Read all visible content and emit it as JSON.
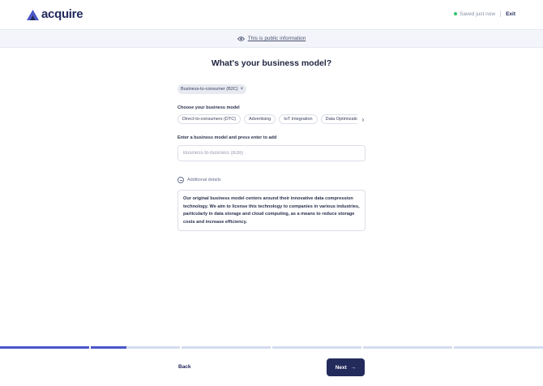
{
  "header": {
    "logo_text": "acquire",
    "saved_text": "Saved just now",
    "exit_label": "Exit",
    "accent_color": "#232a5c",
    "saved_dot_color": "#2bc46a"
  },
  "banner": {
    "text": "This is public information",
    "icon": "eye-icon"
  },
  "main": {
    "title": "What's your business model?",
    "selected_chip": {
      "label": "Business-to-consumer (B2C)",
      "remove_glyph": "×"
    },
    "choose_label": "Choose your business model",
    "options": [
      "Direct-to-consumers (DTC)",
      "Advertising",
      "IoT Integration",
      "Data Optimization"
    ],
    "scroll_glyph": "›",
    "enter_label": "Enter a business model and press enter to add",
    "input": {
      "placeholder": "Business-to-business (B2B)",
      "value": ""
    },
    "details_toggle_label": "Additional details",
    "details_text": "Our original business model centers around their innovative data compression technology. We aim to license this technology to companies in various industries, particularly in data storage and cloud computing, as a means to reduce storage costs and increase efficiency."
  },
  "progress": {
    "segments_total": 6,
    "filled_fraction_by_segment": [
      1,
      0.4,
      0,
      0,
      0,
      0
    ],
    "fill_color": "#4a56c9",
    "track_color": "#d3dcef"
  },
  "footer": {
    "back_label": "Back",
    "next_label": "Next",
    "next_glyph": "→"
  }
}
